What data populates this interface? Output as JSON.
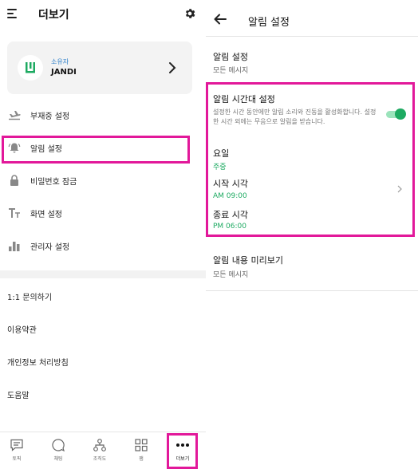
{
  "left": {
    "title": "더보기",
    "profile": {
      "role": "소유자",
      "name": "JANDI"
    },
    "menu": [
      {
        "label": "부재중 설정",
        "icon": "airplane-icon"
      },
      {
        "label": "알림 설정",
        "icon": "bell-icon"
      },
      {
        "label": "비밀번호 잠금",
        "icon": "lock-icon"
      },
      {
        "label": "화면 설정",
        "icon": "text-size-icon"
      },
      {
        "label": "관리자 설정",
        "icon": "bar-chart-icon"
      }
    ],
    "info": [
      {
        "label": "1:1 문의하기"
      },
      {
        "label": "이용약관"
      },
      {
        "label": "개인정보 처리방침"
      },
      {
        "label": "도움말"
      }
    ],
    "nav": [
      {
        "label": "토픽",
        "icon": "chat-list-icon"
      },
      {
        "label": "채팅",
        "icon": "chat-bubble-icon"
      },
      {
        "label": "조직도",
        "icon": "org-chart-icon"
      },
      {
        "label": "잼",
        "icon": "grid-icon"
      },
      {
        "label": "더보기",
        "icon": "more-dots-icon"
      }
    ]
  },
  "right": {
    "title": "알림 설정",
    "notification": {
      "title": "알림 설정",
      "value": "모든 메시지"
    },
    "schedule": {
      "title": "알림 시간대 설정",
      "description": "설정한 시간 동안에만 알림 소리와 진동을 활성화합니다. 설정한 시간 외에는 무음으로 알림을 받습니다.",
      "enabled": true,
      "days_label": "요일",
      "days_value": "주중",
      "start_label": "시작 시각",
      "start_value": "AM 09:00",
      "end_label": "종료 시각",
      "end_value": "PM 06:00"
    },
    "preview": {
      "title": "알림 내용 미리보기",
      "value": "모든 메시지"
    }
  },
  "colors": {
    "accent_green": "#1daa61",
    "highlight": "#e2189a",
    "link_blue": "#2a7ec9"
  }
}
